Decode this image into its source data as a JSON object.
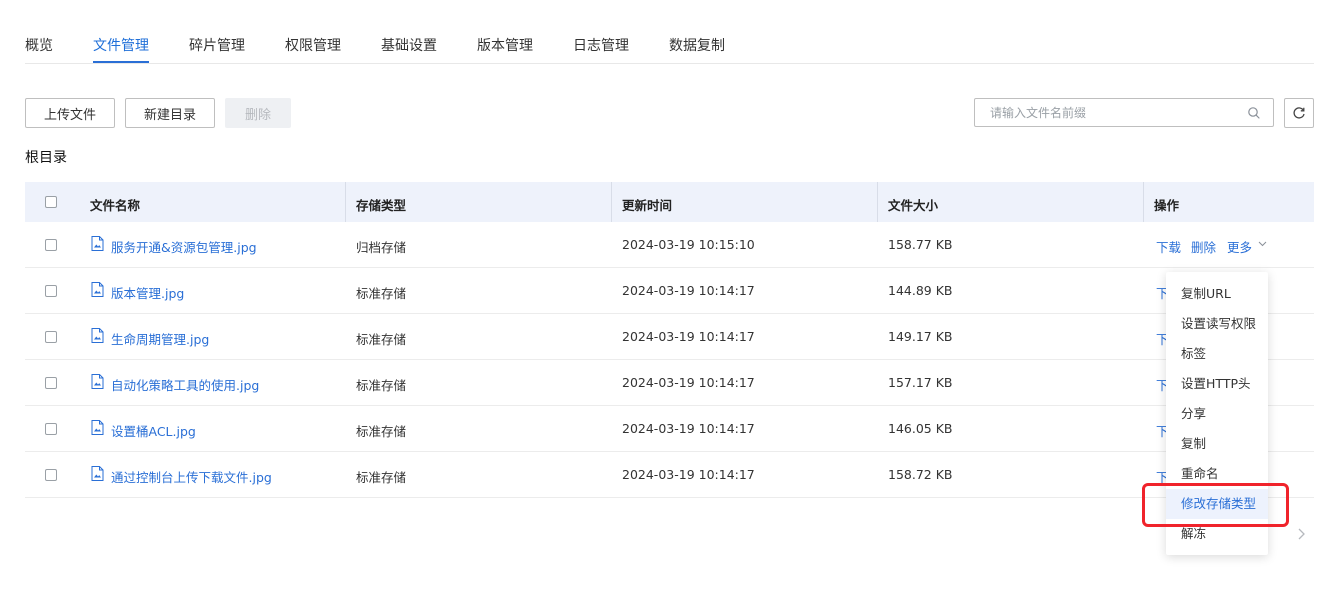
{
  "tabs": [
    {
      "label": "概览"
    },
    {
      "label": "文件管理"
    },
    {
      "label": "碎片管理"
    },
    {
      "label": "权限管理"
    },
    {
      "label": "基础设置"
    },
    {
      "label": "版本管理"
    },
    {
      "label": "日志管理"
    },
    {
      "label": "数据复制"
    }
  ],
  "active_tab": "文件管理",
  "toolbar": {
    "upload_label": "上传文件",
    "new_dir_label": "新建目录",
    "delete_label": "删除",
    "search_placeholder": "请输入文件名前缀",
    "search_value": ""
  },
  "breadcrumb": "根目录",
  "table": {
    "headers": {
      "name": "文件名称",
      "storage": "存储类型",
      "updated": "更新时间",
      "size": "文件大小",
      "ops": "操作"
    },
    "rows": [
      {
        "name": "服务开通&资源包管理.jpg",
        "storage": "归档存储",
        "updated": "2024-03-19 10:15:10",
        "size": "158.77 KB"
      },
      {
        "name": "版本管理.jpg",
        "storage": "标准存储",
        "updated": "2024-03-19 10:14:17",
        "size": "144.89 KB"
      },
      {
        "name": "生命周期管理.jpg",
        "storage": "标准存储",
        "updated": "2024-03-19 10:14:17",
        "size": "149.17 KB"
      },
      {
        "name": "自动化策略工具的使用.jpg",
        "storage": "标准存储",
        "updated": "2024-03-19 10:14:17",
        "size": "157.17 KB"
      },
      {
        "name": "设置桶ACL.jpg",
        "storage": "标准存储",
        "updated": "2024-03-19 10:14:17",
        "size": "146.05 KB"
      },
      {
        "name": "通过控制台上传下载文件.jpg",
        "storage": "标准存储",
        "updated": "2024-03-19 10:14:17",
        "size": "158.72 KB"
      }
    ],
    "row_ops": {
      "download": "下载",
      "delete": "删除",
      "more": "更多",
      "download_truncated": "下"
    }
  },
  "more_menu": {
    "items": [
      {
        "label": "复制URL"
      },
      {
        "label": "设置读写权限"
      },
      {
        "label": "标签"
      },
      {
        "label": "设置HTTP头"
      },
      {
        "label": "分享"
      },
      {
        "label": "复制"
      },
      {
        "label": "重命名"
      },
      {
        "label": "修改存储类型"
      },
      {
        "label": "解冻"
      }
    ],
    "highlighted": "修改存储类型"
  },
  "colors": {
    "accent": "#2a6fd6",
    "header_bg": "#eef2fb",
    "highlight_border": "#f0232b"
  },
  "icons": [
    "file-image-icon",
    "search-icon",
    "refresh-icon",
    "chevron-down-icon",
    "chevron-right-icon"
  ]
}
